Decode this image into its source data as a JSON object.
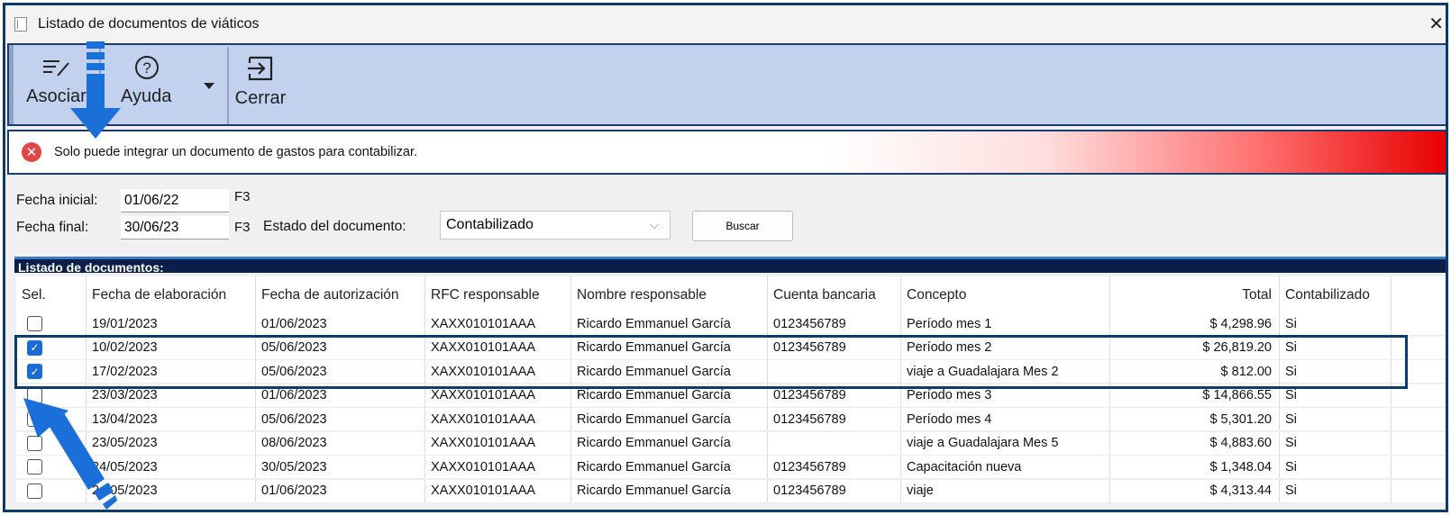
{
  "window": {
    "title": "Listado de documentos de viáticos",
    "close_glyph": "✕"
  },
  "toolbar": {
    "asociar_label": "Asociar",
    "ayuda_label": "Ayuda",
    "cerrar_label": "Cerrar",
    "asociar_icon": "edit-lines-icon",
    "ayuda_icon": "help-circle-icon",
    "cerrar_icon": "exit-arrow-icon"
  },
  "error": {
    "message": "Solo puede integrar un documento de gastos para contabilizar.",
    "icon_glyph": "✕"
  },
  "filters": {
    "fecha_inicial_label": "Fecha inicial:",
    "fecha_inicial_value": "01/06/22",
    "fecha_final_label": "Fecha final:",
    "fecha_final_value": "30/06/23",
    "key_hint": "F3",
    "estado_label": "Estado del documento:",
    "estado_value": "Contabilizado",
    "buscar_label": "Buscar"
  },
  "list_title": "Listado de documentos:",
  "table": {
    "headers": [
      "Sel.",
      "Fecha de elaboración",
      "Fecha de autorización",
      "RFC responsable",
      "Nombre responsable",
      "Cuenta bancaria",
      "Concepto",
      "Total",
      "Contabilizado"
    ],
    "rows": [
      {
        "sel": false,
        "fecha_elab": "19/01/2023",
        "fecha_aut": "01/06/2023",
        "rfc": "XAXX010101AAA",
        "nombre": "Ricardo Emmanuel García",
        "cuenta": "0123456789",
        "concepto": "Período mes 1",
        "total": "$ 4,298.96",
        "contabilizado": "Si"
      },
      {
        "sel": true,
        "fecha_elab": "10/02/2023",
        "fecha_aut": "05/06/2023",
        "rfc": "XAXX010101AAA",
        "nombre": "Ricardo Emmanuel García",
        "cuenta": "0123456789",
        "concepto": "Período mes 2",
        "total": "$ 26,819.20",
        "contabilizado": "Si"
      },
      {
        "sel": true,
        "fecha_elab": "17/02/2023",
        "fecha_aut": "05/06/2023",
        "rfc": "XAXX010101AAA",
        "nombre": "Ricardo Emmanuel García",
        "cuenta": "",
        "concepto": "viaje a Guadalajara Mes 2",
        "total": "$ 812.00",
        "contabilizado": "Si"
      },
      {
        "sel": false,
        "fecha_elab": "23/03/2023",
        "fecha_aut": "01/06/2023",
        "rfc": "XAXX010101AAA",
        "nombre": "Ricardo Emmanuel García",
        "cuenta": "0123456789",
        "concepto": "Período mes 3",
        "total": "$ 14,866.55",
        "contabilizado": "Si"
      },
      {
        "sel": false,
        "fecha_elab": "13/04/2023",
        "fecha_aut": "05/06/2023",
        "rfc": "XAXX010101AAA",
        "nombre": "Ricardo Emmanuel García",
        "cuenta": "0123456789",
        "concepto": "Período mes 4",
        "total": "$ 5,301.20",
        "contabilizado": "Si"
      },
      {
        "sel": false,
        "fecha_elab": "23/05/2023",
        "fecha_aut": "08/06/2023",
        "rfc": "XAXX010101AAA",
        "nombre": "Ricardo Emmanuel García",
        "cuenta": "",
        "concepto": "viaje a Guadalajara Mes 5",
        "total": "$ 4,883.60",
        "contabilizado": "Si"
      },
      {
        "sel": false,
        "fecha_elab": "24/05/2023",
        "fecha_aut": "30/05/2023",
        "rfc": "XAXX010101AAA",
        "nombre": "Ricardo Emmanuel García",
        "cuenta": "0123456789",
        "concepto": "Capacitación nueva",
        "total": "$ 1,348.04",
        "contabilizado": "Si"
      },
      {
        "sel": false,
        "fecha_elab": "24/05/2023",
        "fecha_aut": "01/06/2023",
        "rfc": "XAXX010101AAA",
        "nombre": "Ricardo Emmanuel García",
        "cuenta": "0123456789",
        "concepto": "viaje",
        "total": "$ 4,313.44",
        "contabilizado": "Si"
      }
    ]
  },
  "colors": {
    "toolbar_bg": "#c2d2ee",
    "frame_border": "#0e3a6b",
    "arrow_blue": "#1a6fd8",
    "checkbox_blue": "#1b6bd6",
    "error_red": "#e80000"
  }
}
